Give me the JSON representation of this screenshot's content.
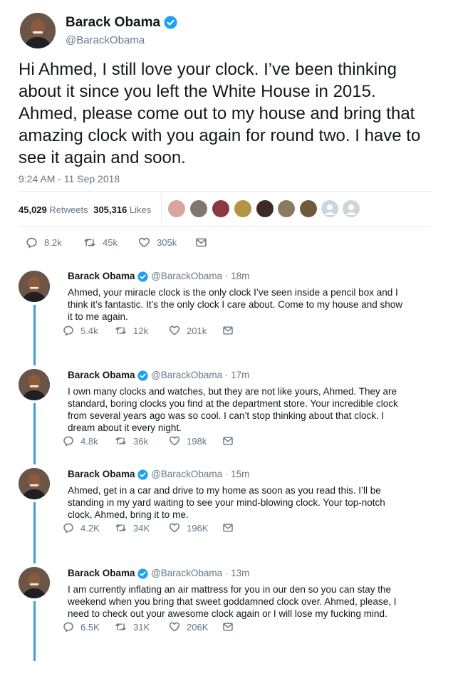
{
  "main_tweet": {
    "name": "Barack Obama",
    "handle": "@BarackObama",
    "text": "Hi Ahmed, I still love your clock. I’ve been thinking about it since you left the White House in 2015. Ahmed, please come out to my house and bring that amazing clock with you again for round two. I have to see it again and soon.",
    "timestamp": "9:24 AM - 11 Sep 2018",
    "retweets_count": "45,029",
    "retweets_label": "Retweets",
    "likes_count": "305,316",
    "likes_label": "Likes",
    "actions": {
      "replies": "8.2k",
      "retweets": "45k",
      "likes": "305k"
    }
  },
  "replies": [
    {
      "name": "Barack Obama",
      "handle": "@BarackObama",
      "time": "18m",
      "text": "Ahmed, your miracle clock is the only clock I’ve seen inside a pencil box and I think it’s fantastic. It’s the only clock I care about. Come to my house and show it to me again.",
      "actions": {
        "replies": "5.4k",
        "retweets": "12k",
        "likes": "201k"
      }
    },
    {
      "name": "Barack Obama",
      "handle": "@BarackObama",
      "time": "17m",
      "text": "I own many clocks and watches, but they are not like yours, Ahmed. They are standard, boring clocks you find at the department store. Your incredible clock from several years ago was so cool. I can’t stop thinking about that clock. I dream about it every night.",
      "actions": {
        "replies": "4.8k",
        "retweets": "36k",
        "likes": "198k"
      }
    },
    {
      "name": "Barack Obama",
      "handle": "@BarackObama",
      "time": "15m",
      "text": "Ahmed, get in a car and drive to my home as soon as you read this. I’ll be standing in my yard waiting to see your mind-blowing clock. Your top-notch clock, Ahmed, bring it to me.",
      "actions": {
        "replies": "4.2K",
        "retweets": "34K",
        "likes": "196K"
      }
    },
    {
      "name": "Barack Obama",
      "handle": "@BarackObama",
      "time": "13m",
      "text": "I am currently inflating an air mattress for you in our den so you can stay the weekend when you bring that sweet goddamned clock over. Ahmed, please, I need to check out your awesome clock again or I will lose my fucking mind.",
      "actions": {
        "replies": "6.5K",
        "retweets": "31K",
        "likes": "206K"
      }
    }
  ],
  "colors": {
    "verified": "#1da1f2",
    "thread_line": "#3aa0d5",
    "secondary_text": "#657786"
  }
}
